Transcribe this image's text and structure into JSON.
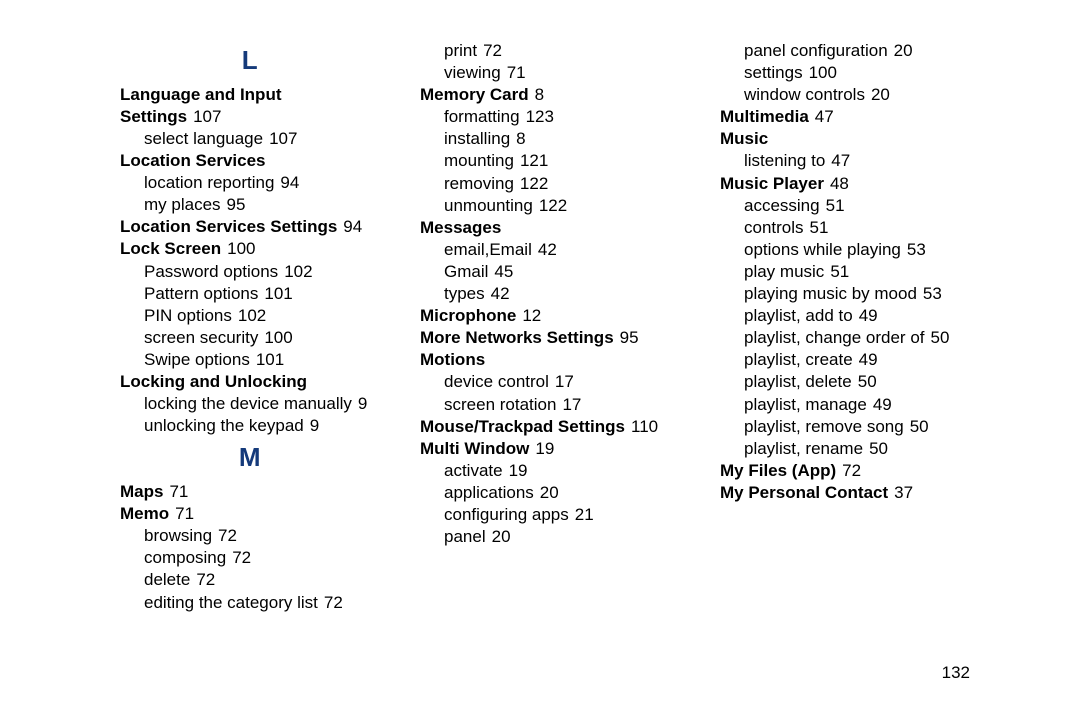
{
  "page_number": "132",
  "columns": [
    {
      "items": [
        {
          "type": "letter",
          "text": "L"
        },
        {
          "type": "topic",
          "label": "Language and Input Settings",
          "page": "107"
        },
        {
          "type": "sub",
          "label": "select language",
          "page": "107"
        },
        {
          "type": "topic",
          "label": "Location Services",
          "page": ""
        },
        {
          "type": "sub",
          "label": "location reporting",
          "page": "94"
        },
        {
          "type": "sub",
          "label": "my places",
          "page": "95"
        },
        {
          "type": "topic",
          "label": "Location Services Settings",
          "page": "94"
        },
        {
          "type": "topic",
          "label": "Lock Screen",
          "page": "100"
        },
        {
          "type": "sub",
          "label": "Password options",
          "page": "102"
        },
        {
          "type": "sub",
          "label": "Pattern options",
          "page": "101"
        },
        {
          "type": "sub",
          "label": "PIN options",
          "page": "102"
        },
        {
          "type": "sub",
          "label": "screen security",
          "page": "100"
        },
        {
          "type": "sub",
          "label": "Swipe options",
          "page": "101"
        },
        {
          "type": "topic",
          "label": "Locking and Unlocking",
          "page": ""
        },
        {
          "type": "sub",
          "label": "locking the device manually",
          "page": "9"
        },
        {
          "type": "sub",
          "label": "unlocking the keypad",
          "page": "9"
        },
        {
          "type": "letter",
          "text": "M"
        },
        {
          "type": "topic",
          "label": "Maps",
          "page": "71"
        },
        {
          "type": "topic",
          "label": "Memo",
          "page": "71"
        },
        {
          "type": "sub",
          "label": "browsing",
          "page": "72"
        },
        {
          "type": "sub",
          "label": "composing",
          "page": "72"
        },
        {
          "type": "sub",
          "label": "delete",
          "page": "72"
        },
        {
          "type": "sub",
          "label": "editing the category list",
          "page": "72"
        }
      ]
    },
    {
      "items": [
        {
          "type": "sub",
          "label": "print",
          "page": "72"
        },
        {
          "type": "sub",
          "label": "viewing",
          "page": "71"
        },
        {
          "type": "topic",
          "label": "Memory Card",
          "page": "8"
        },
        {
          "type": "sub",
          "label": "formatting",
          "page": "123"
        },
        {
          "type": "sub",
          "label": "installing",
          "page": "8"
        },
        {
          "type": "sub",
          "label": "mounting",
          "page": "121"
        },
        {
          "type": "sub",
          "label": "removing",
          "page": "122"
        },
        {
          "type": "sub",
          "label": "unmounting",
          "page": "122"
        },
        {
          "type": "topic",
          "label": "Messages",
          "page": ""
        },
        {
          "type": "sub",
          "label": "email,Email",
          "page": "42"
        },
        {
          "type": "sub",
          "label": "Gmail",
          "page": "45"
        },
        {
          "type": "sub",
          "label": "types",
          "page": "42"
        },
        {
          "type": "topic",
          "label": "Microphone",
          "page": "12"
        },
        {
          "type": "topic",
          "label": "More Networks Settings",
          "page": "95"
        },
        {
          "type": "topic",
          "label": "Motions",
          "page": ""
        },
        {
          "type": "sub",
          "label": "device control",
          "page": "17"
        },
        {
          "type": "sub",
          "label": "screen rotation",
          "page": "17"
        },
        {
          "type": "topic",
          "label": "Mouse/Trackpad Settings",
          "page": "110"
        },
        {
          "type": "topic",
          "label": "Multi Window",
          "page": "19"
        },
        {
          "type": "sub",
          "label": "activate",
          "page": "19"
        },
        {
          "type": "sub",
          "label": "applications",
          "page": "20"
        },
        {
          "type": "sub",
          "label": "configuring apps",
          "page": "21"
        },
        {
          "type": "sub",
          "label": "panel",
          "page": "20"
        }
      ]
    },
    {
      "items": [
        {
          "type": "sub",
          "label": "panel configuration",
          "page": "20"
        },
        {
          "type": "sub",
          "label": "settings",
          "page": "100"
        },
        {
          "type": "sub",
          "label": "window controls",
          "page": "20"
        },
        {
          "type": "topic",
          "label": "Multimedia",
          "page": "47"
        },
        {
          "type": "topic",
          "label": "Music",
          "page": ""
        },
        {
          "type": "sub",
          "label": "listening to",
          "page": "47"
        },
        {
          "type": "topic",
          "label": "Music Player",
          "page": "48"
        },
        {
          "type": "sub",
          "label": "accessing",
          "page": "51"
        },
        {
          "type": "sub",
          "label": "controls",
          "page": "51"
        },
        {
          "type": "sub",
          "label": "options while playing",
          "page": "53"
        },
        {
          "type": "sub",
          "label": "play music",
          "page": "51"
        },
        {
          "type": "sub",
          "label": "playing music by mood",
          "page": "53"
        },
        {
          "type": "sub",
          "label": "playlist, add to",
          "page": "49"
        },
        {
          "type": "sub",
          "label": "playlist, change order of",
          "page": "50"
        },
        {
          "type": "sub",
          "label": "playlist, create",
          "page": "49"
        },
        {
          "type": "sub",
          "label": "playlist, delete",
          "page": "50"
        },
        {
          "type": "sub",
          "label": "playlist, manage",
          "page": "49"
        },
        {
          "type": "sub",
          "label": "playlist, remove song",
          "page": "50"
        },
        {
          "type": "sub",
          "label": "playlist, rename",
          "page": "50"
        },
        {
          "type": "topic",
          "label": "My Files (App)",
          "page": "72"
        },
        {
          "type": "topic",
          "label": "My Personal Contact",
          "page": "37"
        }
      ]
    }
  ]
}
